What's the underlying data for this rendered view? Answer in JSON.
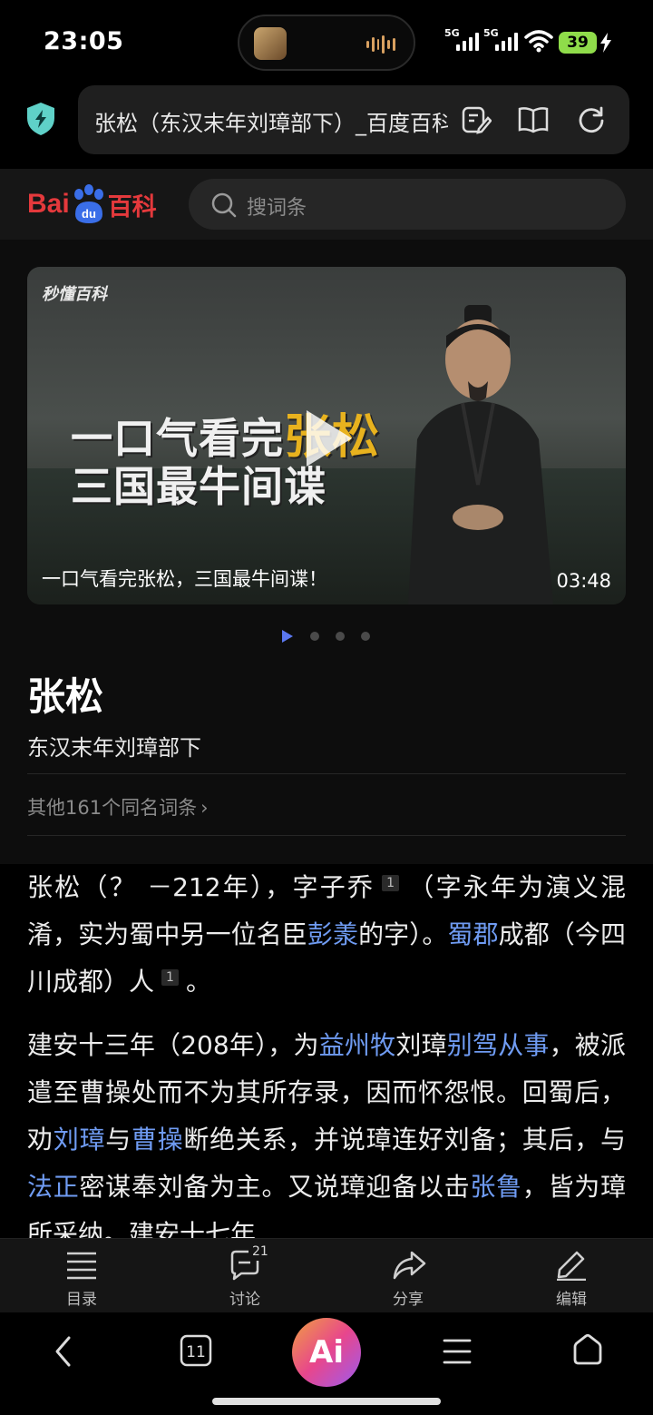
{
  "status_bar": {
    "time": "23:05",
    "net1": "5G",
    "net2": "5G",
    "battery": "39"
  },
  "browser": {
    "url_title": "张松（东汉末年刘璋部下）_百度百科"
  },
  "baike": {
    "search_placeholder": "搜词条",
    "logo_bai": "Bai",
    "logo_du": "du",
    "logo_baike": "百科"
  },
  "video": {
    "watermark": "秒懂百科",
    "line1_prefix": "一口气看完",
    "line1_highlight": "张松",
    "line2": "三国最牛间谍",
    "caption": "一口气看完张松，三国最牛间谍！",
    "duration": "03:48"
  },
  "entry": {
    "title": "张松",
    "subtitle": "东汉末年刘璋部下",
    "same_name": "其他161个同名词条"
  },
  "article": {
    "p1": {
      "a": "张松（？ －212年），字子乔",
      "ref1": "1",
      "b": "（字永年为演义混淆，实为蜀中另一位名臣",
      "link1": "彭羕",
      "c": "的字）。",
      "link2": "蜀郡",
      "d": "成都（今四川成都）人",
      "ref2": "1",
      "e": "。"
    },
    "p2": {
      "a": "建安十三年（208年），为",
      "link1": "益州牧",
      "b": "刘璋",
      "link2": "别驾从事",
      "c": "，被派遣至曹操处而不为其所存录，因而怀怨恨。回蜀后，劝",
      "link3": "刘璋",
      "d": "与",
      "link4": "曹操",
      "e": "断绝关系，并说璋连好刘备；其后，与",
      "link5": "法正",
      "f": "密谋奉刘备为主。又说璋迎备以击",
      "link6": "张鲁",
      "g": "，皆为璋所采纳。建安十七年"
    }
  },
  "toolbar": {
    "toc": "目录",
    "discuss": "讨论",
    "discuss_count": "21",
    "share": "分享",
    "edit": "编辑"
  },
  "nav": {
    "tabs_count": "11",
    "ai_label": "Ai"
  },
  "colors": {
    "link": "#6f9bf2",
    "baike_red": "#e4393c",
    "battery": "#8fdc4a"
  }
}
